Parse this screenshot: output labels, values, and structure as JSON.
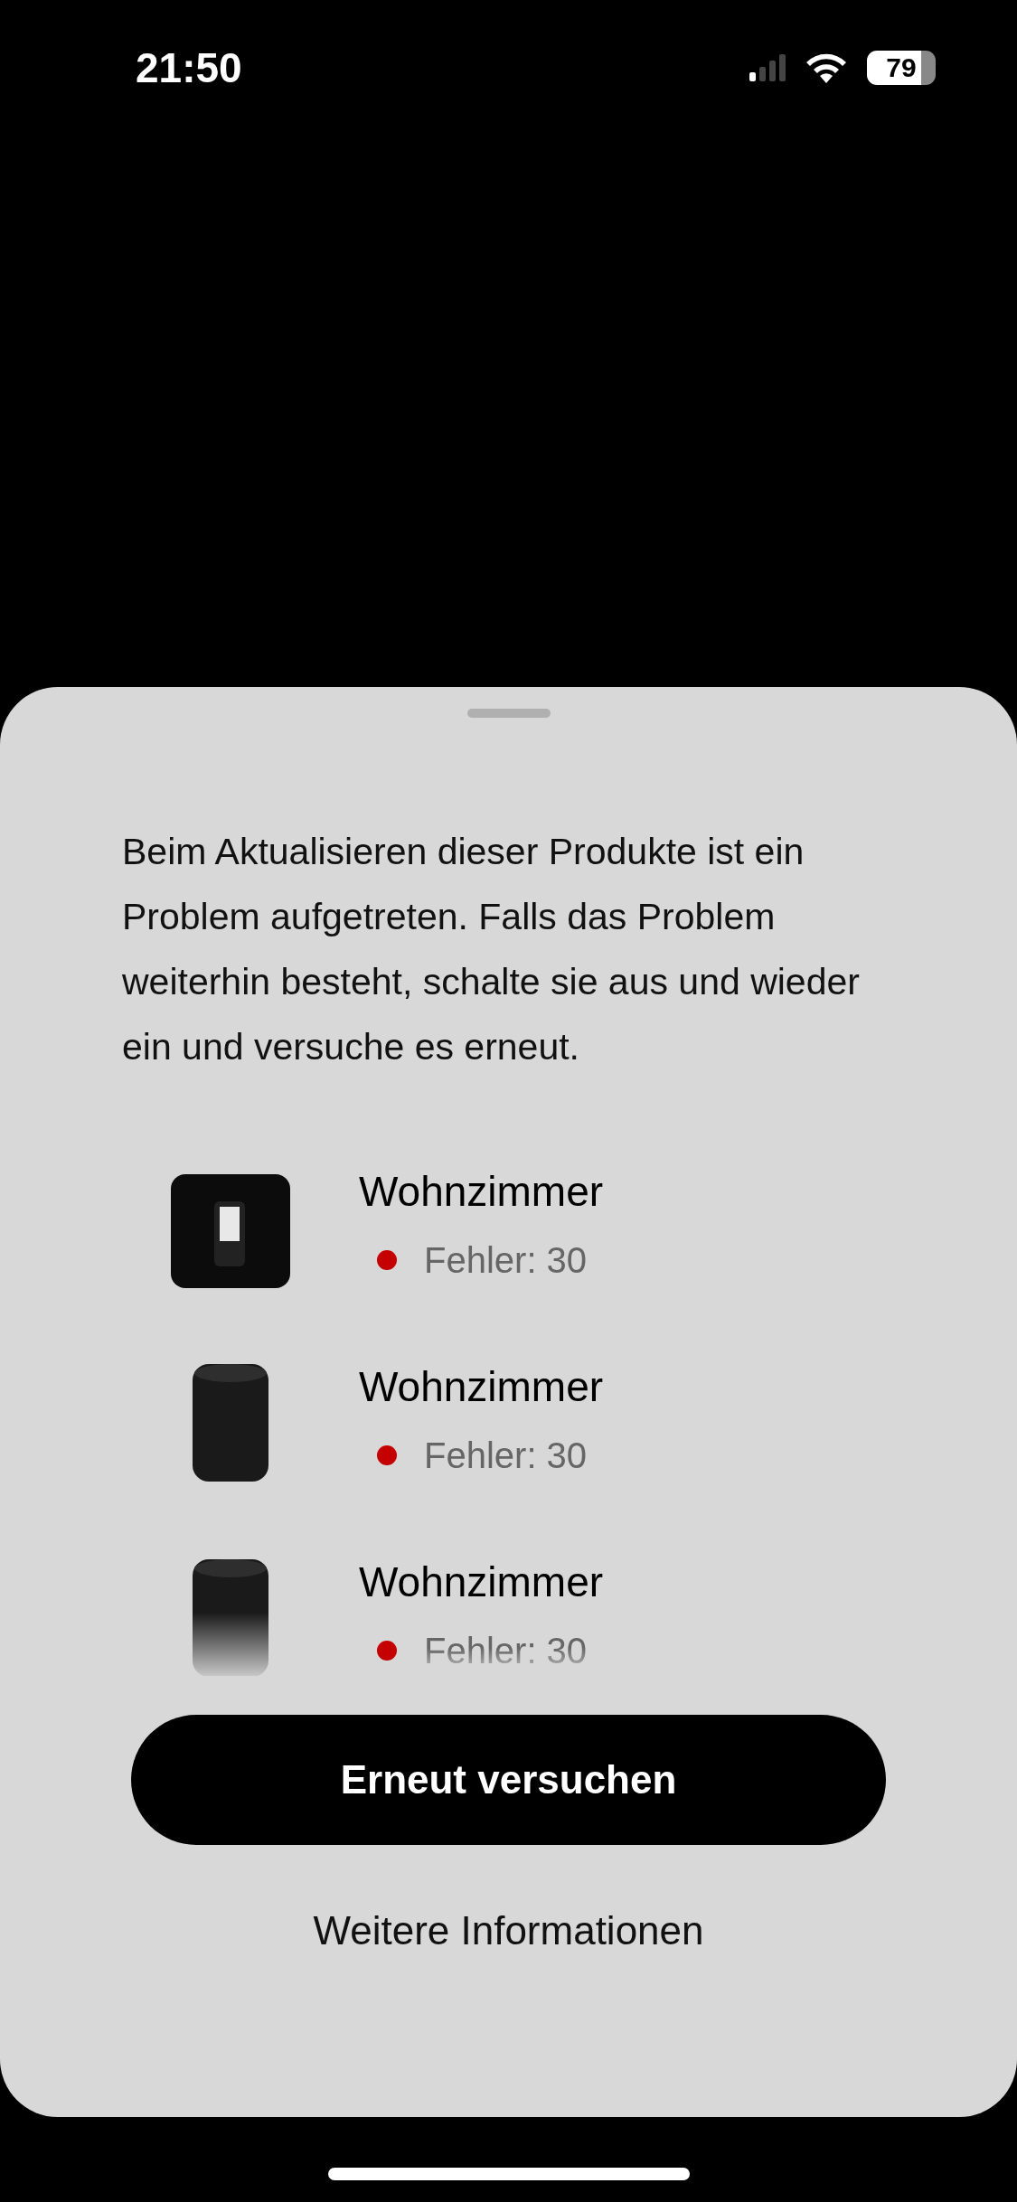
{
  "status_bar": {
    "time": "21:50",
    "battery": "79"
  },
  "sheet": {
    "message": "Beim Aktualisieren dieser Produkte ist ein Problem aufgetreten. Falls das Problem weiterhin besteht, schalte sie aus und wieder ein und versuche es erneut.",
    "products": [
      {
        "kind": "subwoofer",
        "name": "Wohnzimmer",
        "status": "Fehler: 30",
        "color": "#c50000"
      },
      {
        "kind": "speaker",
        "name": "Wohnzimmer",
        "status": "Fehler: 30",
        "color": "#c50000"
      },
      {
        "kind": "speaker",
        "name": "Wohnzimmer",
        "status": "Fehler: 30",
        "color": "#c50000"
      }
    ],
    "primary_button": "Erneut versuchen",
    "secondary_link": "Weitere Informationen"
  }
}
